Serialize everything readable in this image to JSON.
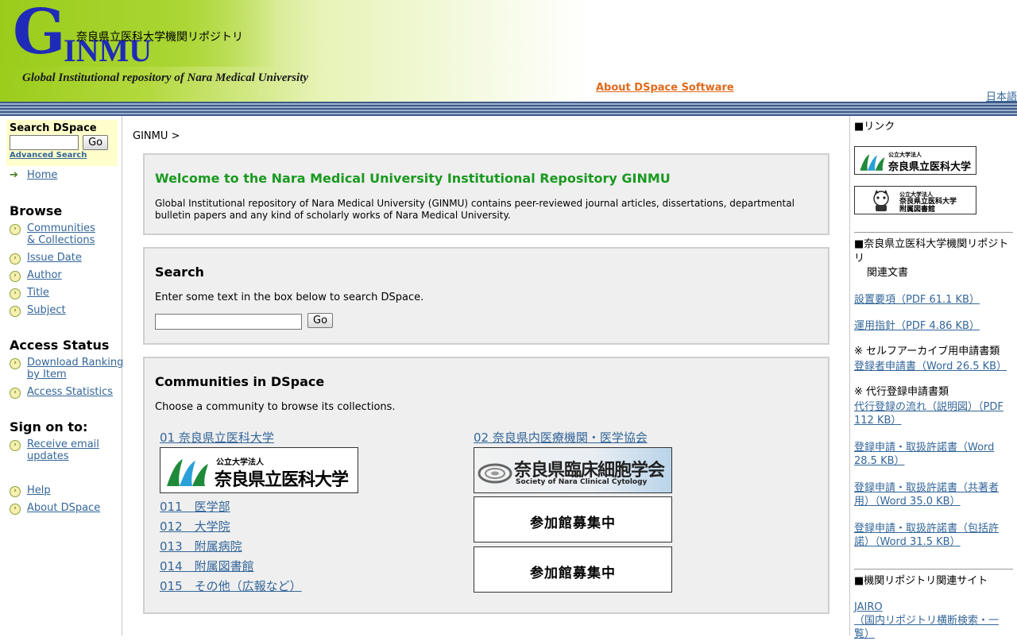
{
  "header": {
    "logo_g": "G",
    "logo_rest": "INMU",
    "logo_jp": "奈良県立医科大学機関リポジトリ",
    "tagline": "Global Institutional repository of Nara Medical University",
    "about_link": "About DSpace Software",
    "language_link": "日本語",
    "colors": {
      "logo_blue": "#1f2bb8",
      "band_green": "#9bcc1b",
      "about_orange": "#e06a1c"
    }
  },
  "leftnav": {
    "search_title": "Search DSpace",
    "search_value": "",
    "go_label": "Go",
    "advanced_search": "Advanced Search",
    "home": "Home",
    "browse_heading": "Browse",
    "browse_items": [
      "Communities & Collections",
      "Issue Date",
      "Author",
      "Title",
      "Subject"
    ],
    "browse_item_0a": "Communities",
    "browse_item_0b": "& Collections",
    "access_heading": "Access Status",
    "download_ranking_a": "Download Ranking",
    "download_ranking_b": " by Item",
    "access_statistics": "Access Statistics",
    "sign_heading": "Sign on to:",
    "receive_email_a": "Receive email",
    "receive_email_b": "updates",
    "help": "Help",
    "about_dspace": "About DSpace"
  },
  "main": {
    "breadcrumb": "GINMU >",
    "welcome_title": "Welcome to the Nara Medical University Institutional Repository GINMU",
    "welcome_text": "Global Institutional repository of Nara Medical University (GINMU) contains peer-reviewed journal articles, dissertations, departmental bulletin papers and any kind of scholarly works of Nara Medical University.",
    "search_title": "Search",
    "search_instructions": "Enter some text in the box below to search DSpace.",
    "search_value": "",
    "go_label": "Go",
    "communities_title": "Communities in DSpace",
    "communities_instructions": "Choose a community to browse its collections.",
    "community_left": "01 奈良県立医科大学",
    "community_right": "02 奈良県内医療機関・医学協会",
    "sub_communities": [
      "011　医学部",
      "012　大学院",
      "013　附属病院",
      "014　附属図書館",
      "015　その他（広報など）"
    ],
    "banner_nmu_small": "公立大学法人",
    "banner_nmu_big": "奈良県立医科大学",
    "banner_soc_big": "奈良県臨床細胞学会",
    "banner_soc_small": "Society of Nara Clinical Cytology",
    "banner_recruit": "参加館募集中"
  },
  "right": {
    "links_heading": "■リンク",
    "lib_small": "公立大学法人",
    "lib_big1": "奈良県立医科大学",
    "lib_big2": "附属図書館",
    "repo_heading": "■奈良県立医科大学機関リポジトリ",
    "related_docs": "関連文書",
    "doc1": "設置要項（PDF 61.1 KB）",
    "doc2": "運用指針（PDF 4.86 KB）",
    "self_archive_heading": "※ セルフアーカイブ用申請書類",
    "doc3": "登録者申請書（Word 26.5 KB）",
    "proxy_heading": "※ 代行登録申請書類",
    "doc4": "代行登録の流れ（説明図）（PDF 112 KB）",
    "doc5": "登録申請・取扱許諾書（Word 28.5 KB）",
    "doc6": "登録申請・取扱許諾書（共著者用）（Word 35.0 KB）",
    "doc7": "登録申請・取扱許諾書（包括許諾）（Word 31.5 KB）",
    "related_sites_heading": "■機関リポジトリ関連サイト",
    "jairo": "JAIRO",
    "jairo_desc": "（国内リポジトリ横断検索・一覧）"
  }
}
